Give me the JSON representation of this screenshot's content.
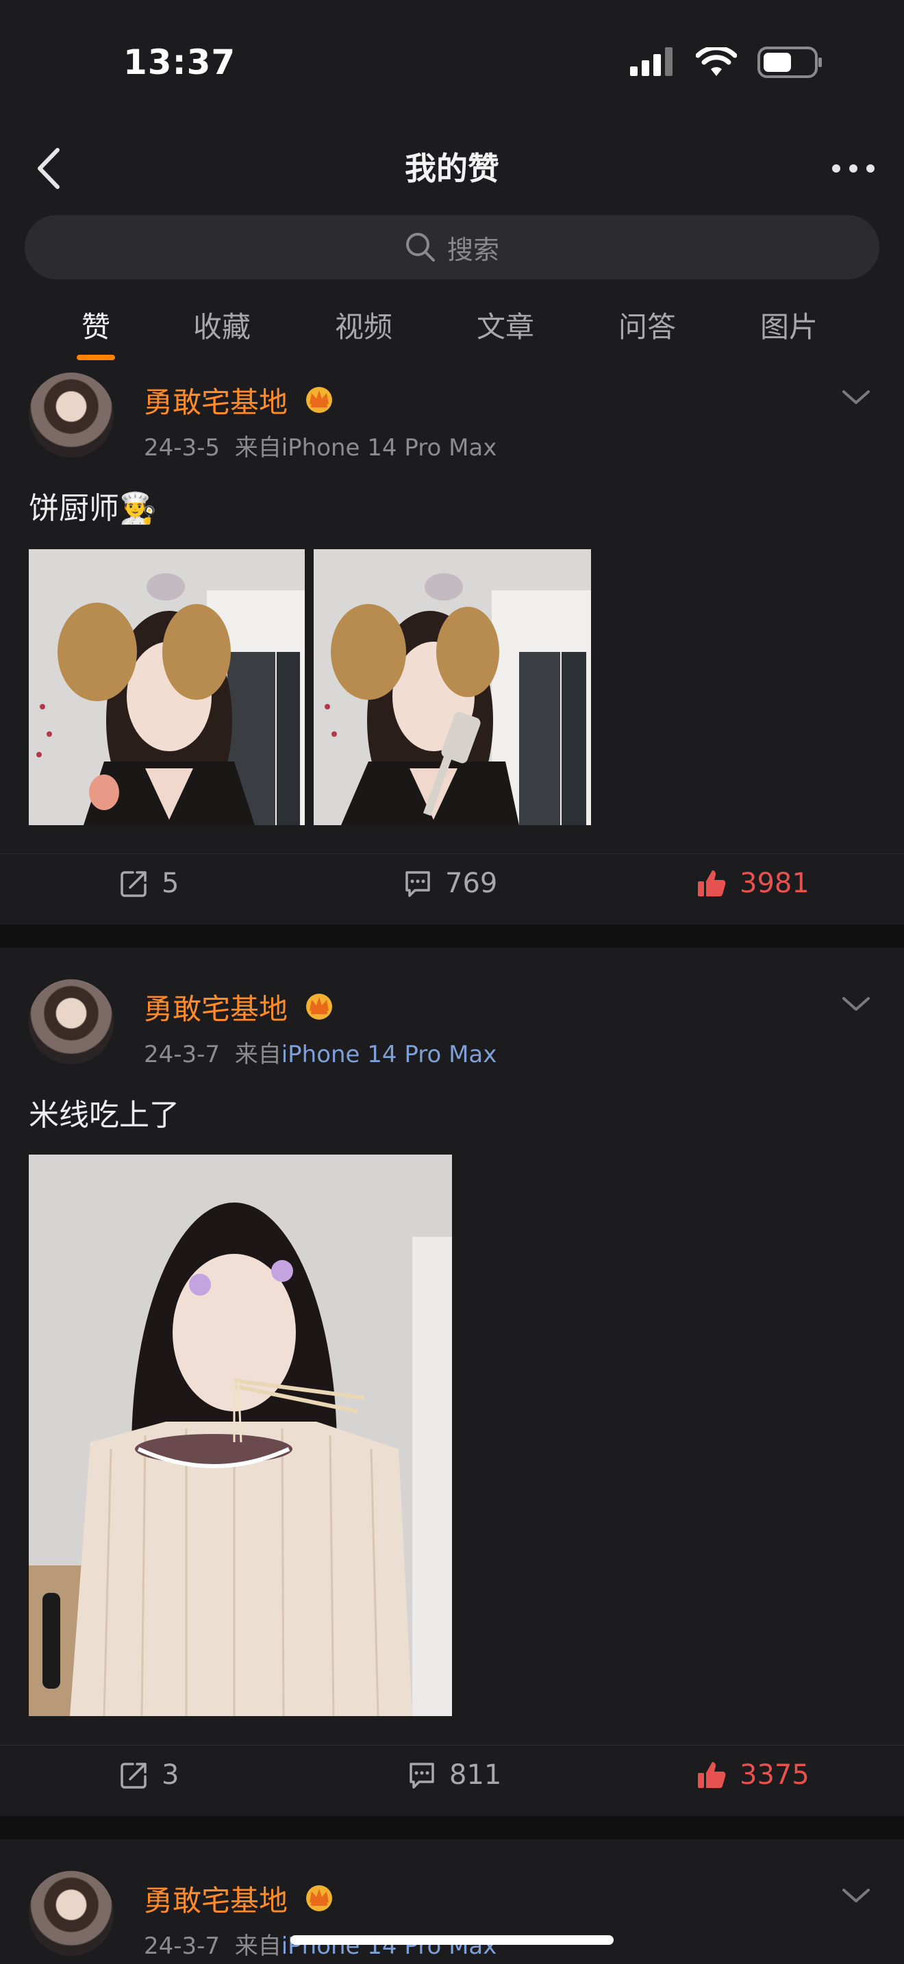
{
  "status_bar": {
    "time": "13:37"
  },
  "navbar": {
    "title": "我的赞"
  },
  "search": {
    "placeholder": "搜索"
  },
  "tabs": [
    {
      "label": "赞",
      "active": true
    },
    {
      "label": "收藏"
    },
    {
      "label": "视频"
    },
    {
      "label": "文章"
    },
    {
      "label": "问答"
    },
    {
      "label": "图片"
    }
  ],
  "posts": [
    {
      "user": "勇敢宅基地",
      "date": "24-3-5",
      "source_prefix": "来自",
      "device": "iPhone 14 Pro Max",
      "text": "饼厨师👨‍🍳",
      "reposts": "5",
      "comments": "769",
      "likes": "3981"
    },
    {
      "user": "勇敢宅基地",
      "date": "24-3-7",
      "source_prefix": "来自",
      "device": "iPhone 14 Pro Max",
      "text": "米线吃上了",
      "reposts": "3",
      "comments": "811",
      "likes": "3375"
    },
    {
      "user": "勇敢宅基地",
      "date": "24-3-7",
      "source_prefix": "来自",
      "device": "iPhone 14 Pro Max"
    }
  ],
  "colors": {
    "accent": "#ff8200",
    "like": "#e5524f",
    "username": "#ff8a28",
    "device_link": "#7ea0d6"
  }
}
